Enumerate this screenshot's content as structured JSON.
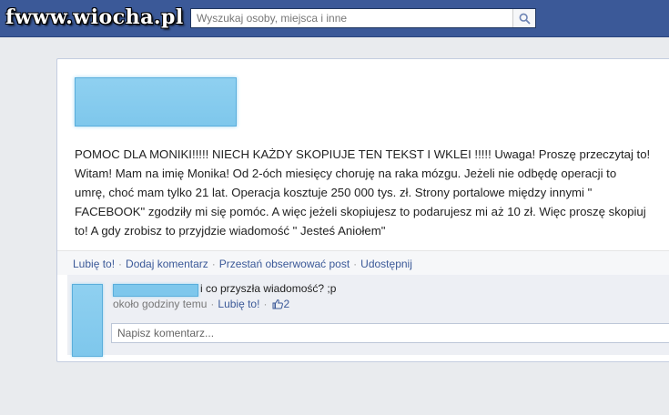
{
  "header": {
    "logo_text": "fwww.wiocha.pl",
    "search": {
      "placeholder": "Wyszukaj osoby, miejsca i inne",
      "value": ""
    },
    "search_icon": "magnifier-icon"
  },
  "post": {
    "text": "POMOC DLA MONIKI!!!!! NIECH KAŻDY SKOPIUJE TEN TEKST I WKLEI !!!!! Uwaga! Proszę przeczytaj to!\nWitam! Mam na imię Monika! Od 2-óch miesięcy choruję na raka mózgu. Jeżeli nie odbędę operacji to\numrę, choć mam tylko 21 lat. Operacja kosztuje 250 000 tys. zł. Strony portalowe między innymi \"\nFACEBOOK\" zgodziły mi się pomóc. A więc jeżeli skopiujesz to podarujesz mi aż 10 zł. Więc proszę skopiuj\nto! A gdy zrobisz to przyjdzie wiadomość \" Jesteś Aniołem\"",
    "actions": {
      "like": "Lubię to!",
      "comment": "Dodaj komentarz",
      "unfollow": "Przestań obserwować post",
      "share": "Udostępnij",
      "separator": "·"
    }
  },
  "comments": {
    "items": [
      {
        "text": "i co przyszła wiadomość? ;p",
        "time": "około godziny temu",
        "separator": "·",
        "like_label": "Lubię to!",
        "like_count": "2",
        "like_icon": "thumbs-up-icon"
      }
    ],
    "input_placeholder": "Napisz komentarz..."
  },
  "colors": {
    "facebook_blue": "#3b5998",
    "redacted_blur": "#7ec7ec"
  }
}
